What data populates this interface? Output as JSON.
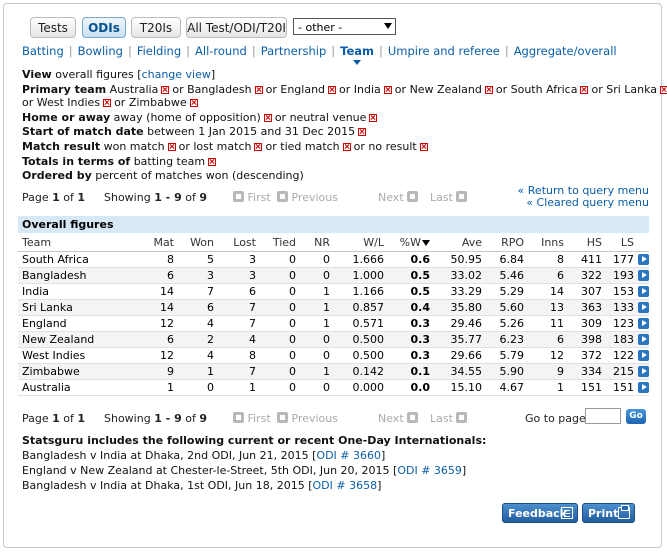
{
  "tabs": [
    {
      "label": "Tests",
      "active": false
    },
    {
      "label": "ODIs",
      "active": true
    },
    {
      "label": "T20Is",
      "active": false
    },
    {
      "label": "All Test/ODI/T20I",
      "active": false
    }
  ],
  "other_select": "- other -",
  "view_links": [
    "Batting",
    "Bowling",
    "Fielding",
    "All-round",
    "Partnership",
    "Team",
    "Umpire and referee",
    "Aggregate/overall"
  ],
  "active_view": "Team",
  "criteria": {
    "view_label": "View",
    "view_text": "overall figures",
    "change_view": "change view",
    "primary_label": "Primary team",
    "primary_first": "Australia",
    "or": "or",
    "primary_rest": [
      "Bangladesh",
      "England",
      "India",
      "New Zealand",
      "South Africa",
      "Sri Lanka"
    ],
    "primary_rest2": [
      "West Indies",
      "Zimbabwe"
    ],
    "home_label": "Home or away",
    "home_text": "away (home of opposition)",
    "home_text2": "neutral venue",
    "start_label": "Start of match date",
    "start_text": "between 1 Jan 2015 and 31 Dec 2015",
    "result_label": "Match result",
    "result_text": "won match",
    "result_2": "lost match",
    "result_3": "tied match",
    "result_4": "no result",
    "totals_label": "Totals in terms of",
    "totals_text": "batting team",
    "ordered_label": "Ordered by",
    "ordered_text": "percent of matches won (descending)"
  },
  "pagination": {
    "page_word": "Page",
    "page": "1",
    "of_word": "of",
    "pages": "1",
    "showing_word": "Showing",
    "range": "1 - 9",
    "total": "9",
    "first": "First",
    "previous": "Previous",
    "next": "Next",
    "last": "Last"
  },
  "return_query": "Return to query menu",
  "cleared_query": "Cleared query menu",
  "table": {
    "title": "Overall figures",
    "columns": [
      "Team",
      "Mat",
      "Won",
      "Lost",
      "Tied",
      "NR",
      "W/L",
      "%W",
      "Ave",
      "RPO",
      "Inns",
      "HS",
      "LS"
    ],
    "rows": [
      [
        "South Africa",
        "8",
        "5",
        "3",
        "0",
        "0",
        "1.666",
        "0.6",
        "50.95",
        "6.84",
        "8",
        "411",
        "177"
      ],
      [
        "Bangladesh",
        "6",
        "3",
        "3",
        "0",
        "0",
        "1.000",
        "0.5",
        "33.02",
        "5.46",
        "6",
        "322",
        "193"
      ],
      [
        "India",
        "14",
        "7",
        "6",
        "0",
        "1",
        "1.166",
        "0.5",
        "33.29",
        "5.29",
        "14",
        "307",
        "153"
      ],
      [
        "Sri Lanka",
        "14",
        "6",
        "7",
        "0",
        "1",
        "0.857",
        "0.4",
        "35.80",
        "5.60",
        "13",
        "363",
        "133"
      ],
      [
        "England",
        "12",
        "4",
        "7",
        "0",
        "1",
        "0.571",
        "0.3",
        "29.46",
        "5.26",
        "11",
        "309",
        "123"
      ],
      [
        "New Zealand",
        "6",
        "2",
        "4",
        "0",
        "0",
        "0.500",
        "0.3",
        "35.77",
        "6.23",
        "6",
        "398",
        "183"
      ],
      [
        "West Indies",
        "12",
        "4",
        "8",
        "0",
        "0",
        "0.500",
        "0.3",
        "29.66",
        "5.79",
        "12",
        "372",
        "122"
      ],
      [
        "Zimbabwe",
        "9",
        "1",
        "7",
        "0",
        "1",
        "0.142",
        "0.1",
        "34.55",
        "5.90",
        "9",
        "334",
        "215"
      ],
      [
        "Australia",
        "1",
        "0",
        "1",
        "0",
        "0",
        "0.000",
        "0.0",
        "15.10",
        "4.67",
        "1",
        "151",
        "151"
      ]
    ]
  },
  "goto_label": "Go to page",
  "go_label": "Go",
  "footer": {
    "heading": "Statsguru includes the following current or recent One-Day Internationals:",
    "matches": [
      {
        "text": "Bangladesh v India at Dhaka, 2nd ODI, Jun 21, 2015",
        "ref": "ODI # 3660"
      },
      {
        "text": "England v New Zealand at Chester-le-Street, 5th ODI, Jun 20, 2015",
        "ref": "ODI # 3659"
      },
      {
        "text": "Bangladesh v India at Dhaka, 1st ODI, Jun 18, 2015",
        "ref": "ODI # 3658"
      }
    ]
  },
  "buttons": {
    "feedback": "Feedback",
    "print": "Print"
  },
  "colors": {
    "link": "#0a5ea8",
    "header_bg": "#d7e9f7",
    "button": "#2b6fb5",
    "remove_x": "#cc0000"
  }
}
